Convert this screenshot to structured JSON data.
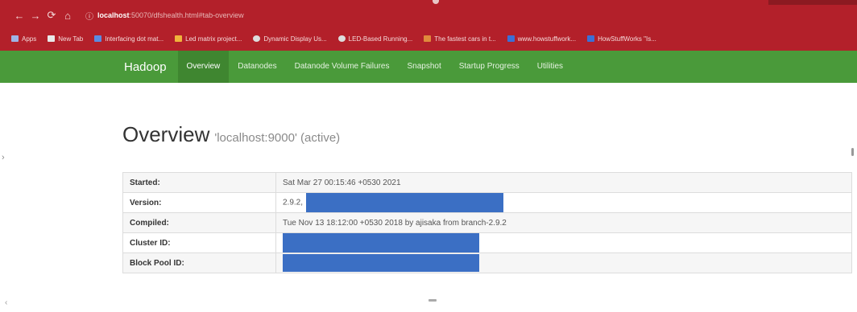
{
  "browser": {
    "url_host": "localhost",
    "url_rest": ":50070/dfshealth.html#tab-overview",
    "bookmarks": [
      {
        "label": "Apps",
        "color": "#9fb3e6"
      },
      {
        "label": "New Tab",
        "color": "#e8e8e8"
      },
      {
        "label": "Interfacing dot mat...",
        "color": "#5b8be0"
      },
      {
        "label": "Led matrix project...",
        "color": "#f0b43c"
      },
      {
        "label": "Dynamic Display Us...",
        "color": "#dddddd"
      },
      {
        "label": "LED-Based Running...",
        "color": "#dddddd"
      },
      {
        "label": "The fastest cars in t...",
        "color": "#e08a3c"
      },
      {
        "label": "www.howstuffwork...",
        "color": "#3c6fd6"
      },
      {
        "label": "HowStuffWorks \"Is...",
        "color": "#3c6fd6"
      }
    ]
  },
  "navbar": {
    "brand": "Hadoop",
    "items": [
      "Overview",
      "Datanodes",
      "Datanode Volume Failures",
      "Snapshot",
      "Startup Progress",
      "Utilities"
    ],
    "active": "Overview"
  },
  "page": {
    "title": "Overview",
    "subtitle": "'localhost:9000' (active)"
  },
  "info_table": [
    {
      "key": "Started:",
      "value": "Sat Mar 27 00:15:46 +0530 2021"
    },
    {
      "key": "Version:",
      "value": "2.9.2,"
    },
    {
      "key": "Compiled:",
      "value": "Tue Nov 13 18:12:00 +0530 2018 by ajisaka from branch-2.9.2"
    },
    {
      "key": "Cluster ID:",
      "value": ""
    },
    {
      "key": "Block Pool ID:",
      "value": ""
    }
  ],
  "colors": {
    "browser_bar": "#b3202a",
    "navbar": "#4a9a3a",
    "navbar_active": "#3f8630",
    "redaction": "#3b6fc4"
  }
}
